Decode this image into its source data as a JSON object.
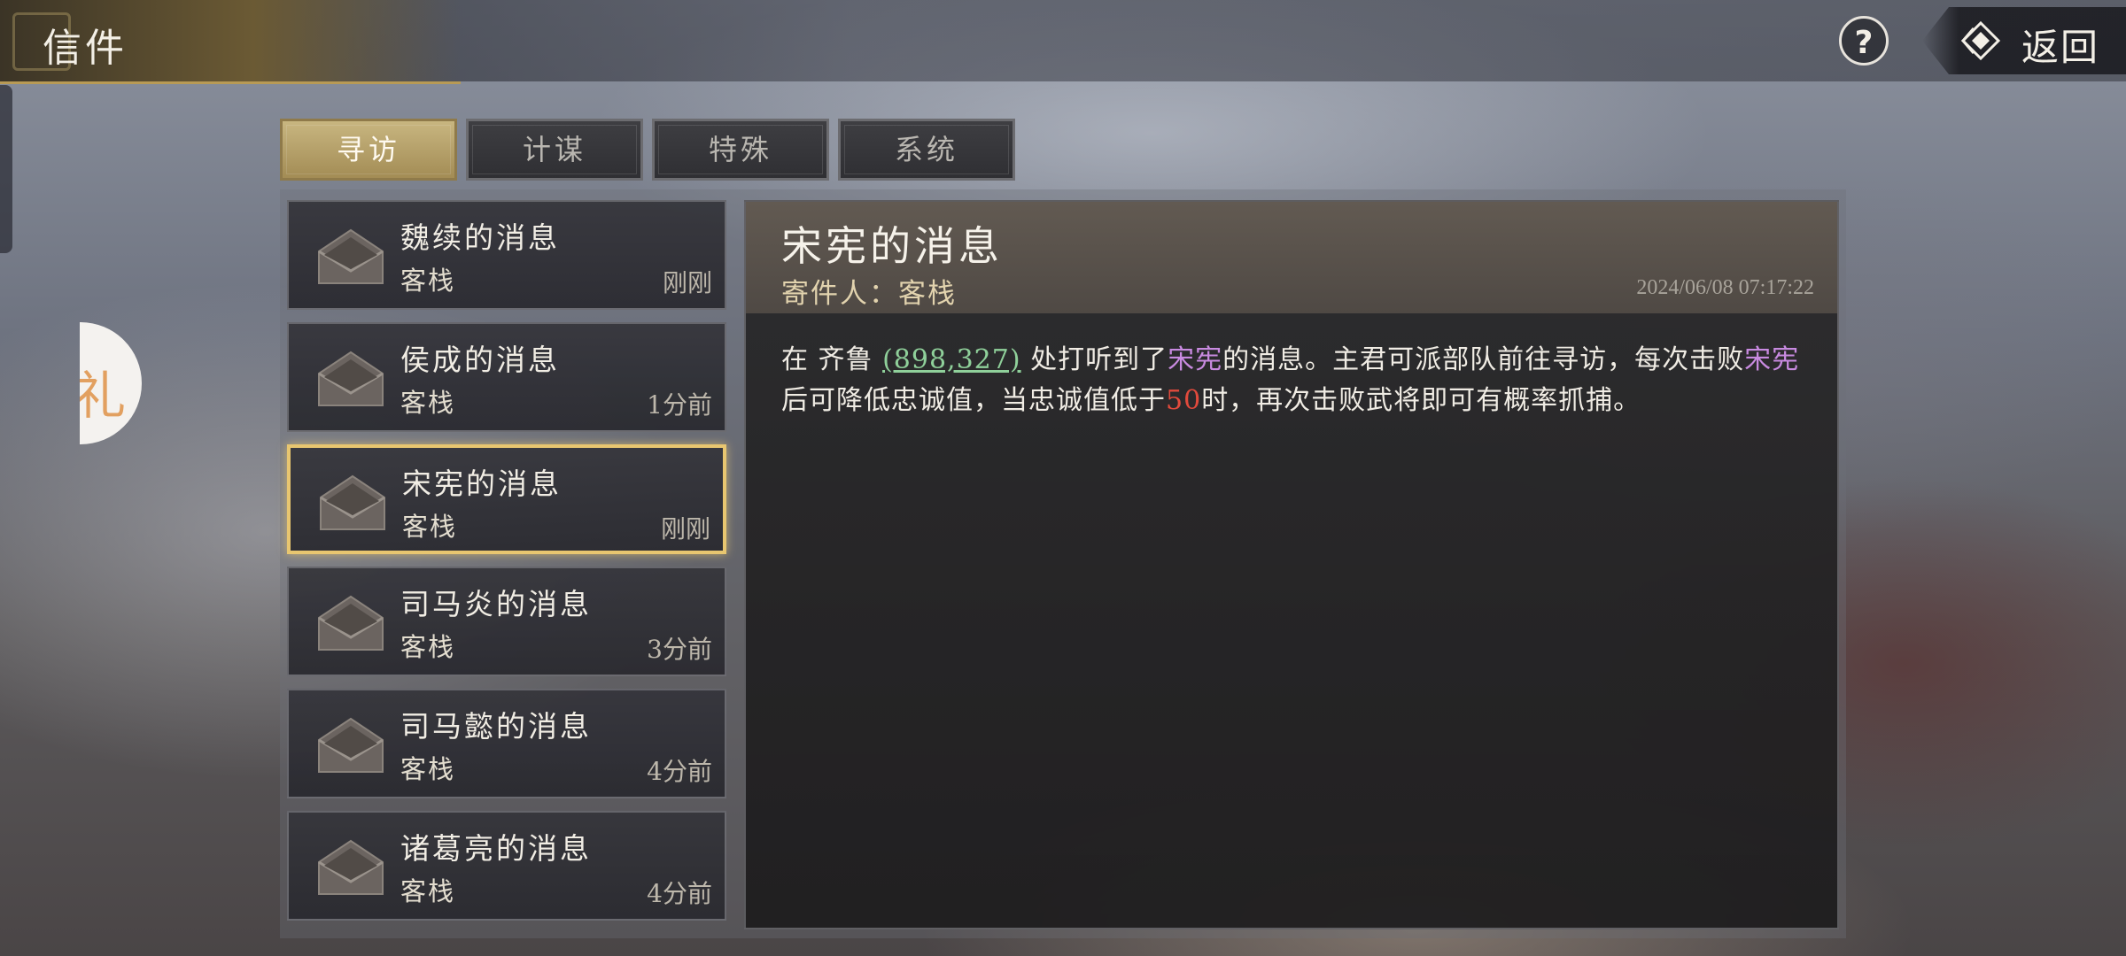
{
  "header": {
    "title": "信件",
    "help_label": "?",
    "back_label": "返回"
  },
  "side_badge": {
    "text": "礼"
  },
  "tabs": [
    {
      "label": "寻访",
      "active": true
    },
    {
      "label": "计谋",
      "active": false
    },
    {
      "label": "特殊",
      "active": false
    },
    {
      "label": "系统",
      "active": false
    }
  ],
  "mails": [
    {
      "subject": "魏续的消息",
      "sender": "客栈",
      "time": "刚刚",
      "selected": false
    },
    {
      "subject": "侯成的消息",
      "sender": "客栈",
      "time": "1分前",
      "selected": false
    },
    {
      "subject": "宋宪的消息",
      "sender": "客栈",
      "time": "刚刚",
      "selected": true
    },
    {
      "subject": "司马炎的消息",
      "sender": "客栈",
      "time": "3分前",
      "selected": false
    },
    {
      "subject": "司马懿的消息",
      "sender": "客栈",
      "time": "4分前",
      "selected": false
    },
    {
      "subject": "诸葛亮的消息",
      "sender": "客栈",
      "time": "4分前",
      "selected": false
    }
  ],
  "detail": {
    "title": "宋宪的消息",
    "from_label": "寄件人：",
    "from_value": "客栈",
    "date": "2024/06/08 07:17:22",
    "body": {
      "part1": "在 齐鲁 ",
      "coord": "(898,327)",
      "part2": " 处打听到了",
      "name1": "宋宪",
      "part3": "的消息。主君可派部队前往寻访，每次击败",
      "name2": "宋宪",
      "part4": "后可降低忠诚值，当忠诚值低于",
      "threshold": "50",
      "part5": "时，再次击败武将即可有概率抓捕。"
    }
  },
  "colors": {
    "accent_gold": "#e8c670",
    "coord_green": "#8fd09a",
    "name_purple": "#c88ae0",
    "number_red": "#e14a3c"
  },
  "icons": {
    "back": "diamond-arrow-icon",
    "mail": "envelope-icon",
    "help": "question-icon"
  }
}
